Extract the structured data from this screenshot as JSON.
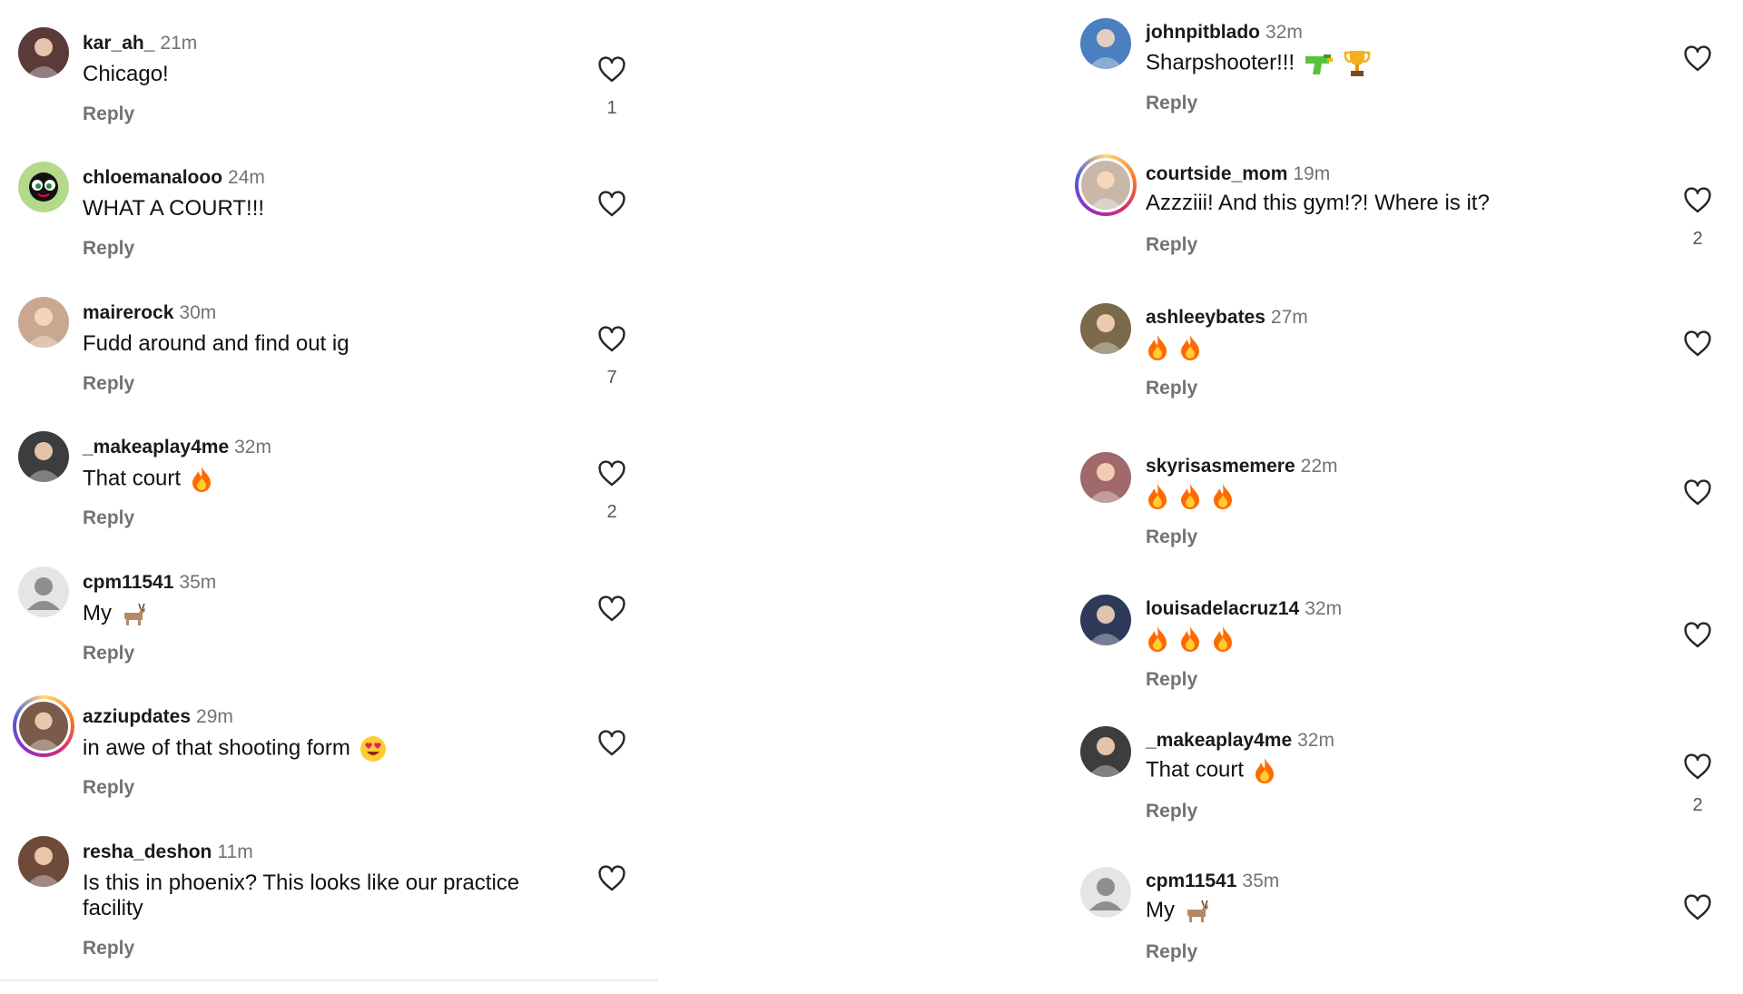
{
  "reply_label": "Reply",
  "colors": {
    "muted": "#737373",
    "heart_stroke": "#262626",
    "flame": "#ff6a00"
  },
  "left_comments": [
    {
      "username": "kar_ah_",
      "time": "21m",
      "text": "Chicago!",
      "emojis": [],
      "likes": "1",
      "avatar": "photo-red"
    },
    {
      "username": "chloemanalooo",
      "time": "24m",
      "text": "WHAT A COURT!!!",
      "emojis": [],
      "likes": "",
      "avatar": "cartoon-green"
    },
    {
      "username": "mairerock",
      "time": "30m",
      "text": "Fudd around and find out ig",
      "emojis": [],
      "likes": "7",
      "avatar": "photo-woman"
    },
    {
      "username": "_makeaplay4me",
      "time": "32m",
      "text": "That court",
      "emojis": [
        "flame"
      ],
      "likes": "2",
      "avatar": "photo-man-bw"
    },
    {
      "username": "cpm11541",
      "time": "35m",
      "text": "My",
      "emojis": [
        "goat"
      ],
      "likes": "",
      "avatar": "default-silhouette"
    },
    {
      "username": "azziupdates",
      "time": "29m",
      "text": "in awe of that shooting form",
      "emojis": [
        "heart-eyes"
      ],
      "likes": "",
      "avatar": "story-photo"
    },
    {
      "username": "resha_deshon",
      "time": "11m",
      "text": "Is this in phoenix? This looks like our practice facility",
      "emojis": [],
      "likes": "",
      "avatar": "photo-woman-2"
    }
  ],
  "right_comments": [
    {
      "username": "johnpitblado",
      "time": "32m",
      "text": "Sharpshooter!!!",
      "emojis": [
        "water-pistol",
        "trophy"
      ],
      "likes": "",
      "avatar": "photo-blue"
    },
    {
      "username": "courtside_mom",
      "time": "19m",
      "text": "Azzziii! And this gym!?! Where is it?",
      "emojis": [],
      "likes": "2",
      "avatar": "story-photo-2"
    },
    {
      "username": "ashleeybates",
      "time": "27m",
      "text": "",
      "emojis": [
        "flame",
        "flame"
      ],
      "likes": "",
      "avatar": "photo-woman-3"
    },
    {
      "username": "skyrisasmemere",
      "time": "22m",
      "text": "",
      "emojis": [
        "flame",
        "flame",
        "flame"
      ],
      "likes": "",
      "avatar": "photo-woman-4"
    },
    {
      "username": "louisadelacruz14",
      "time": "32m",
      "text": "",
      "emojis": [
        "flame",
        "flame",
        "flame"
      ],
      "likes": "",
      "avatar": "photo-woman-5"
    },
    {
      "username": "_makeaplay4me",
      "time": "32m",
      "text": "That court",
      "emojis": [
        "flame"
      ],
      "likes": "2",
      "avatar": "photo-man-bw"
    },
    {
      "username": "cpm11541",
      "time": "35m",
      "text": "My",
      "emojis": [
        "goat"
      ],
      "likes": "",
      "avatar": "default-silhouette"
    }
  ]
}
